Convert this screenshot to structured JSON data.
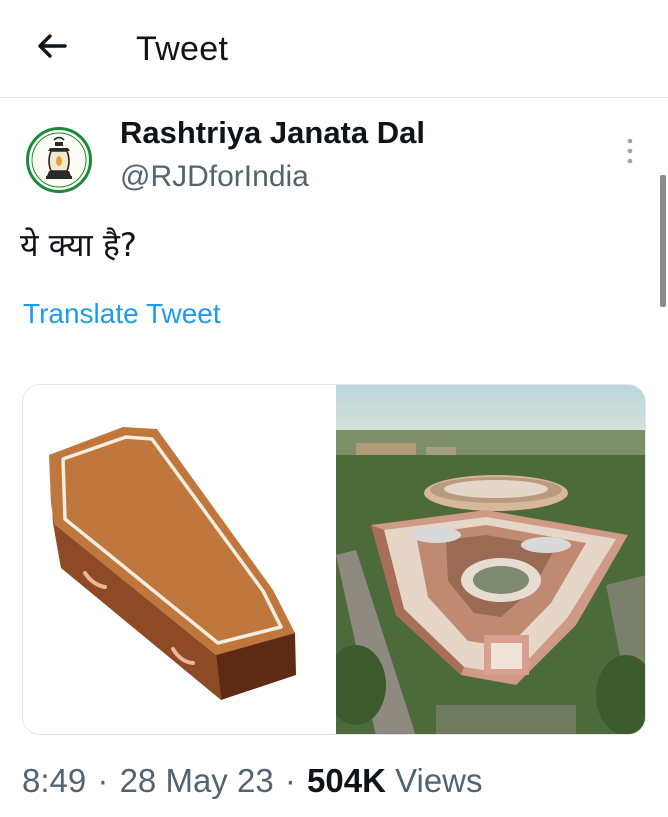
{
  "header": {
    "title": "Tweet",
    "back_icon": "arrow-left-icon"
  },
  "author": {
    "name": "Rashtriya Janata Dal",
    "handle": "@RJDforIndia",
    "avatar_icon": "lantern-logo-icon",
    "brand_color": "#1a8a3a"
  },
  "tweet": {
    "text": "ये क्या है?",
    "translate_label": "Translate Tweet"
  },
  "media": [
    {
      "name": "coffin-image",
      "description_icon": "coffin-icon"
    },
    {
      "name": "parliament-aerial-photo",
      "description_icon": "building-photo"
    }
  ],
  "meta": {
    "time": "8:49",
    "date": "28 May 23",
    "views_count": "504K",
    "views_label": "Views",
    "separator": "·"
  },
  "colors": {
    "link": "#1d9bf0",
    "secondary_text": "#536471",
    "primary_text": "#0f1419"
  }
}
